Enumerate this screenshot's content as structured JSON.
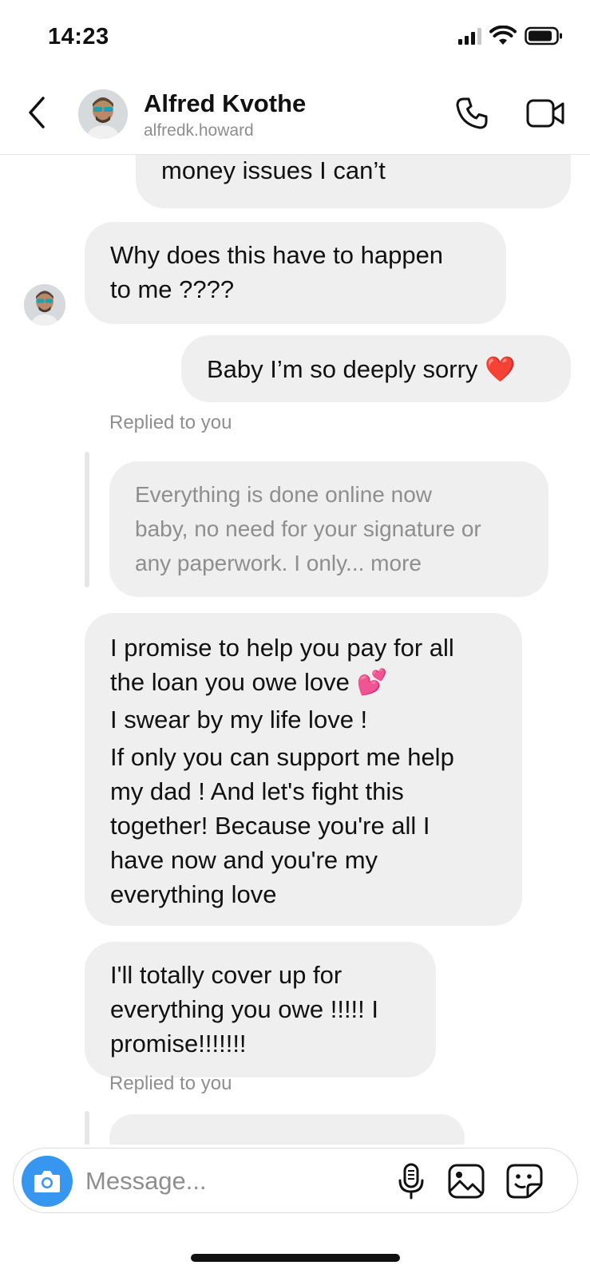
{
  "status_bar": {
    "time": "14:23"
  },
  "header": {
    "contact_name": "Alfred Kvothe",
    "contact_handle": "alfredk.howard",
    "icons": [
      "back-chevron-icon",
      "phone-icon",
      "video-camera-icon"
    ]
  },
  "messages": [
    {
      "side": "outgoing",
      "lines": [
        "money issues I can’t"
      ]
    },
    {
      "side": "incoming",
      "lines": [
        "Why does this have to happen",
        "to me ????"
      ]
    },
    {
      "side": "outgoing",
      "lines": [
        "Baby I’m so deeply sorry ❤️"
      ]
    },
    {
      "side": "incoming",
      "reply_label": "Replied to you",
      "quoted_lines": [
        "Everything is done online now",
        "baby, no need for your signature or",
        "any paperwork. I only... more"
      ],
      "lines": [
        "I promise to help you pay for all",
        "the loan you owe love 💕",
        "I swear by my life love !",
        "If only you can support me help",
        "my dad ! And let's fight this",
        "together! Because you're all I",
        "have now and you're my",
        "everything love"
      ]
    },
    {
      "side": "incoming",
      "lines": [
        "I'll totally cover up for",
        "everything you owe !!!!! I",
        "promise!!!!!!!"
      ]
    },
    {
      "side": "incoming",
      "reply_label": "Replied to you"
    }
  ],
  "composer": {
    "placeholder": "Message...",
    "accent_color": "#3797f0",
    "icons": [
      "camera-icon",
      "microphone-icon",
      "gallery-icon",
      "sticker-icon"
    ]
  },
  "colors": {
    "bubble": "#efefef",
    "secondary_text": "#8e8e8e",
    "accent": "#3797f0"
  }
}
